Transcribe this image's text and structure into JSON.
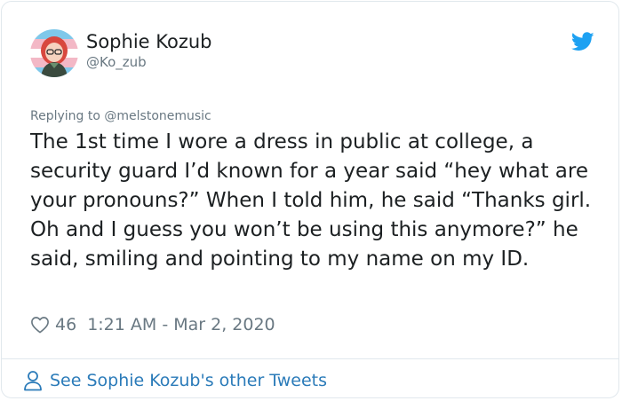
{
  "tweet": {
    "author_name": "Sophie Kozub",
    "author_handle": "@Ko_zub",
    "replying_prefix": "Replying to",
    "replying_to": "@melstonemusic",
    "text": "The 1st time I wore a dress in public at college, a security guard I’d known for a year said “hey what are your pronouns?” When I told him, he said “Thanks girl. Oh and I guess you won’t be using this anymore?” he said, smiling and pointing to my name on my ID.",
    "like_count": "46",
    "timestamp": "1:21 AM - Mar 2, 2020"
  },
  "footer": {
    "link_label": "See Sophie Kozub's other Tweets"
  },
  "icons": {
    "brand": "twitter-bird-icon",
    "like": "heart-icon",
    "profile": "person-icon"
  },
  "colors": {
    "brand": "#1da1f2",
    "link": "#2b7bb9",
    "text": "#1c2022",
    "muted": "#697882",
    "border": "#e1e8ed"
  }
}
